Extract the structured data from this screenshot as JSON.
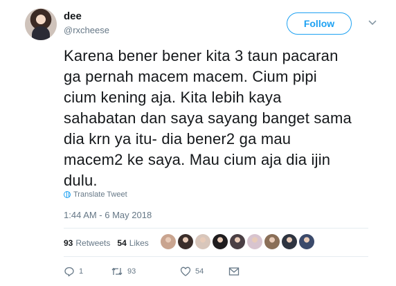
{
  "user": {
    "display_name": "dee",
    "handle": "@rxcheese"
  },
  "follow_label": "Follow",
  "tweet_text": "Karena bener bener kita 3 taun pacaran\nga pernah macem macem. Cium pipi\ncium kening aja. Kita lebih kaya\nsahabatan dan saya sayang banget sama\ndia krn ya itu- dia bener2 ga mau\nmacem2 ke saya. Mau cium aja dia ijin\ndulu.",
  "translate_label": "Translate Tweet",
  "timestamp": "1:44 AM - 6 May 2018",
  "stats": {
    "retweets_count": "93",
    "retweets_label": "Retweets",
    "likes_count": "54",
    "likes_label": "Likes"
  },
  "likers": [
    {
      "color": "#c9a48f"
    },
    {
      "color": "#3a2d2a"
    },
    {
      "color": "#d8c6bb"
    },
    {
      "color": "#1f1d1f"
    },
    {
      "color": "#4a3f44"
    },
    {
      "color": "#d8c4cf"
    },
    {
      "color": "#8a6f58"
    },
    {
      "color": "#2e3440"
    },
    {
      "color": "#3b4a6b"
    }
  ],
  "actions": {
    "reply_count": "1",
    "retweet_count": "93",
    "like_count": "54"
  },
  "colors": {
    "accent": "#1da1f2",
    "text": "#14171a",
    "muted": "#657786"
  }
}
